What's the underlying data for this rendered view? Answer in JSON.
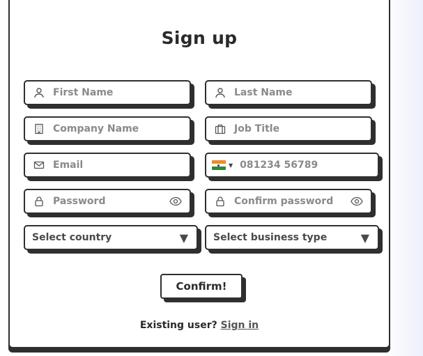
{
  "form": {
    "title": "Sign up",
    "first_name_placeholder": "First Name",
    "last_name_placeholder": "Last Name",
    "company_placeholder": "Company Name",
    "job_title_placeholder": "Job Title",
    "email_placeholder": "Email",
    "phone_placeholder": "081234 56789",
    "password_placeholder": "Password",
    "confirm_password_placeholder": "Confirm password",
    "country_select": "Select country",
    "business_select": "Select business type",
    "confirm_button": "Confirm!",
    "existing_user_text": "Existing user?",
    "sign_in_link": "Sign in"
  },
  "icons": {
    "first_name": "user-icon",
    "last_name": "user-icon",
    "company": "building-icon",
    "job_title": "briefcase-icon",
    "email": "mail-icon",
    "phone_flag": "india-flag-icon",
    "password": "lock-icon",
    "confirm_password": "lock-icon",
    "password_visibility": "eye-icon",
    "dropdown": "triangle-down-icon"
  },
  "colors": {
    "border": "#2f2f2f",
    "placeholder": "#8a8a8a",
    "text": "#2a2a2a",
    "background": "#ffffff"
  }
}
